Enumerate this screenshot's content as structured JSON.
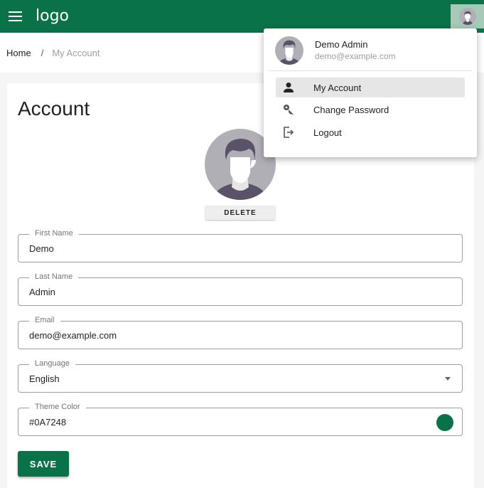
{
  "appbar": {
    "logo": "logo"
  },
  "breadcrumb": {
    "home": "Home",
    "separator": "/",
    "current": "My Account"
  },
  "account": {
    "title": "Account",
    "delete_label": "DELETE",
    "fields": {
      "first_name": {
        "label": "First Name",
        "value": "Demo"
      },
      "last_name": {
        "label": "Last Name",
        "value": "Admin"
      },
      "email": {
        "label": "Email",
        "value": "demo@example.com"
      },
      "language": {
        "label": "Language",
        "value": "English"
      },
      "theme_color": {
        "label": "Theme Color",
        "value": "#0A7248"
      }
    },
    "save_label": "SAVE"
  },
  "user_menu": {
    "name": "Demo Admin",
    "email": "demo@example.com",
    "items": [
      {
        "label": "My Account",
        "icon": "person-icon",
        "active": true
      },
      {
        "label": "Change Password",
        "icon": "key-icon",
        "active": false
      },
      {
        "label": "Logout",
        "icon": "logout-icon",
        "active": false
      }
    ]
  },
  "colors": {
    "primary": "#0a7248",
    "avatar_bg": "#b0afb5",
    "avatar_hair": "#5b5168"
  }
}
